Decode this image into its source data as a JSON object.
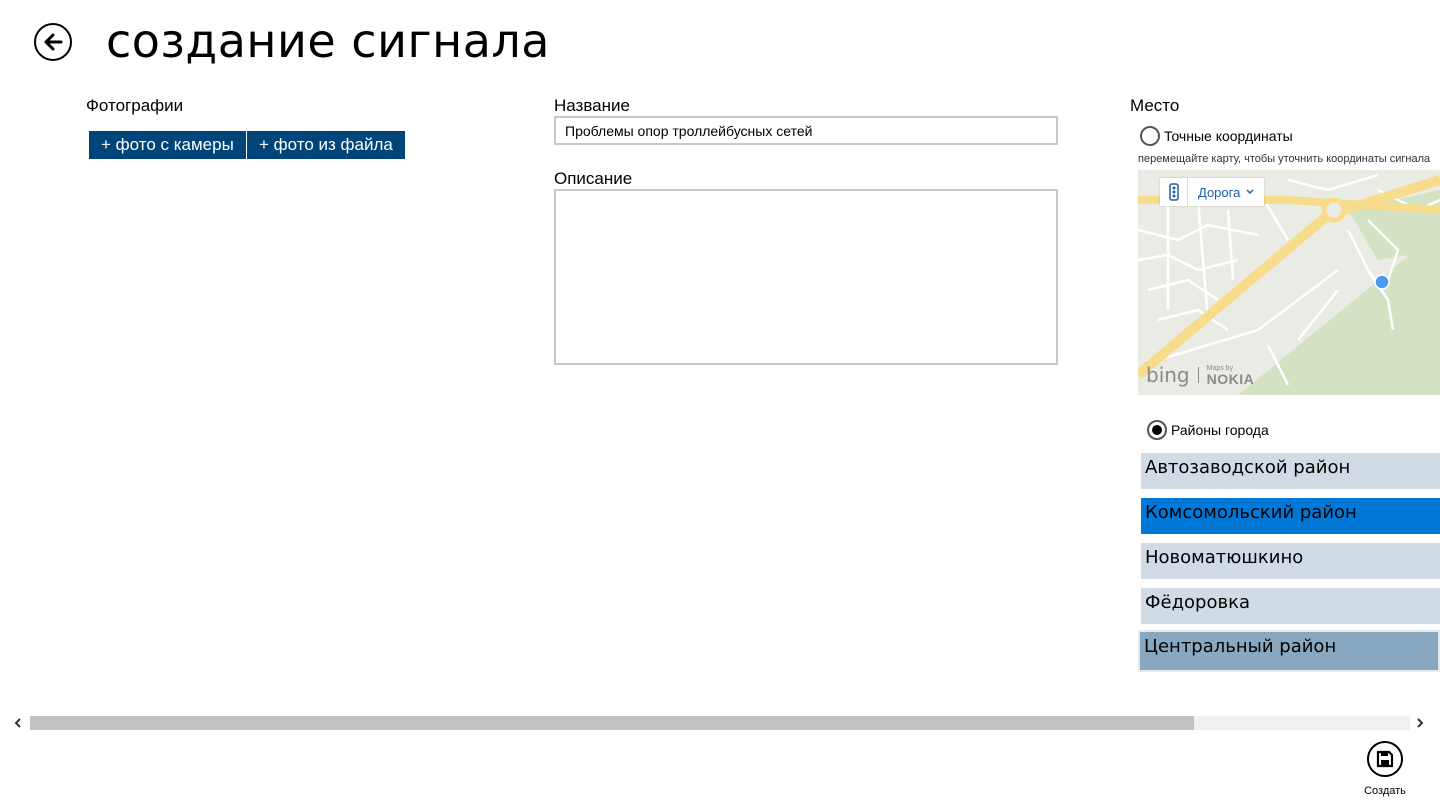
{
  "header": {
    "title": "создание сигнала"
  },
  "photos": {
    "label": "Фотографии",
    "camera_button": "+ фото с камеры",
    "file_button": "+ фото из файла"
  },
  "form": {
    "name_label": "Название",
    "name_value": "Проблемы опор троллейбусных сетей",
    "description_label": "Описание",
    "description_value": ""
  },
  "place": {
    "label": "Место",
    "exact_coords_label": "Точные координаты",
    "exact_coords_checked": false,
    "hint": "перемещайте карту, чтобы уточнить координаты сигнала",
    "map": {
      "style_label": "Дорога",
      "traffic_icon": "traffic-light-icon",
      "credit_bing": "bing",
      "credit_mapsby": "Maps by",
      "credit_nokia": "NOKIA"
    },
    "districts_label": "Районы города",
    "districts_checked": true,
    "districts": [
      {
        "label": "Автозаводской район",
        "state": "normal"
      },
      {
        "label": "Комсомольский район",
        "state": "selected"
      },
      {
        "label": "Новоматюшкино",
        "state": "normal"
      },
      {
        "label": "Фёдоровка",
        "state": "normal"
      },
      {
        "label": "Центральный район",
        "state": "hover"
      }
    ]
  },
  "appbar": {
    "create_label": "Создать",
    "create_icon": "save-icon"
  },
  "colors": {
    "accent": "#0078d7",
    "button_bg": "#00457a",
    "list_bg": "#d1dbe6",
    "list_hover": "#88a8c2"
  }
}
